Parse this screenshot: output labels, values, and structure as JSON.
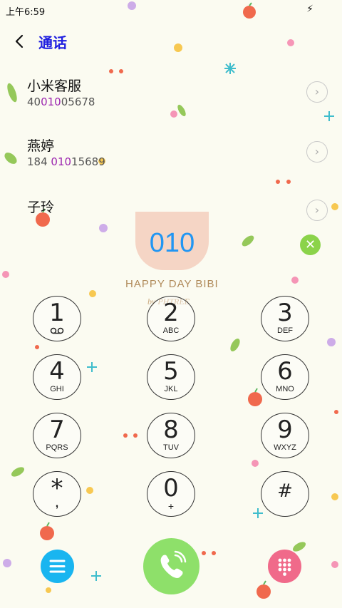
{
  "status_bar": {
    "time": "上午6:59"
  },
  "header": {
    "title": "通话"
  },
  "contacts": [
    {
      "name": "小米客服",
      "number_pre": "40",
      "number_match": "010",
      "number_post": "05678"
    },
    {
      "name": "燕婷",
      "number_pre": "184 ",
      "number_match": "010",
      "number_post": "15689"
    },
    {
      "name": "子玲",
      "number_pre": "",
      "number_match": "",
      "number_post": ""
    }
  ],
  "dialer": {
    "number": "010",
    "brand": "HAPPY DAY BIBI",
    "brand_sub": "by PHTREE"
  },
  "keys": [
    {
      "digit": "1",
      "letters": ""
    },
    {
      "digit": "2",
      "letters": "ABC"
    },
    {
      "digit": "3",
      "letters": "DEF"
    },
    {
      "digit": "4",
      "letters": "GHI"
    },
    {
      "digit": "5",
      "letters": "JKL"
    },
    {
      "digit": "6",
      "letters": "MNO"
    },
    {
      "digit": "7",
      "letters": "PQRS"
    },
    {
      "digit": "8",
      "letters": "TUV"
    },
    {
      "digit": "9",
      "letters": "WXYZ"
    },
    {
      "digit": "*",
      "letters": ","
    },
    {
      "digit": "0",
      "letters": "+"
    },
    {
      "digit": "#",
      "letters": ""
    }
  ],
  "colors": {
    "accent_blue": "#2196f3",
    "title_blue": "#1f1fe0",
    "match_purple": "#9c27b0",
    "call_green": "#8ee06a",
    "menu_blue": "#19b5f0",
    "keypad_pink": "#f06a8a"
  },
  "icons": {
    "back": "chevron-left-icon",
    "detail": "chevron-right-icon",
    "clear": "close-icon",
    "menu": "menu-icon",
    "call": "phone-icon",
    "keypad": "dialpad-icon",
    "voicemail": "voicemail-icon"
  }
}
